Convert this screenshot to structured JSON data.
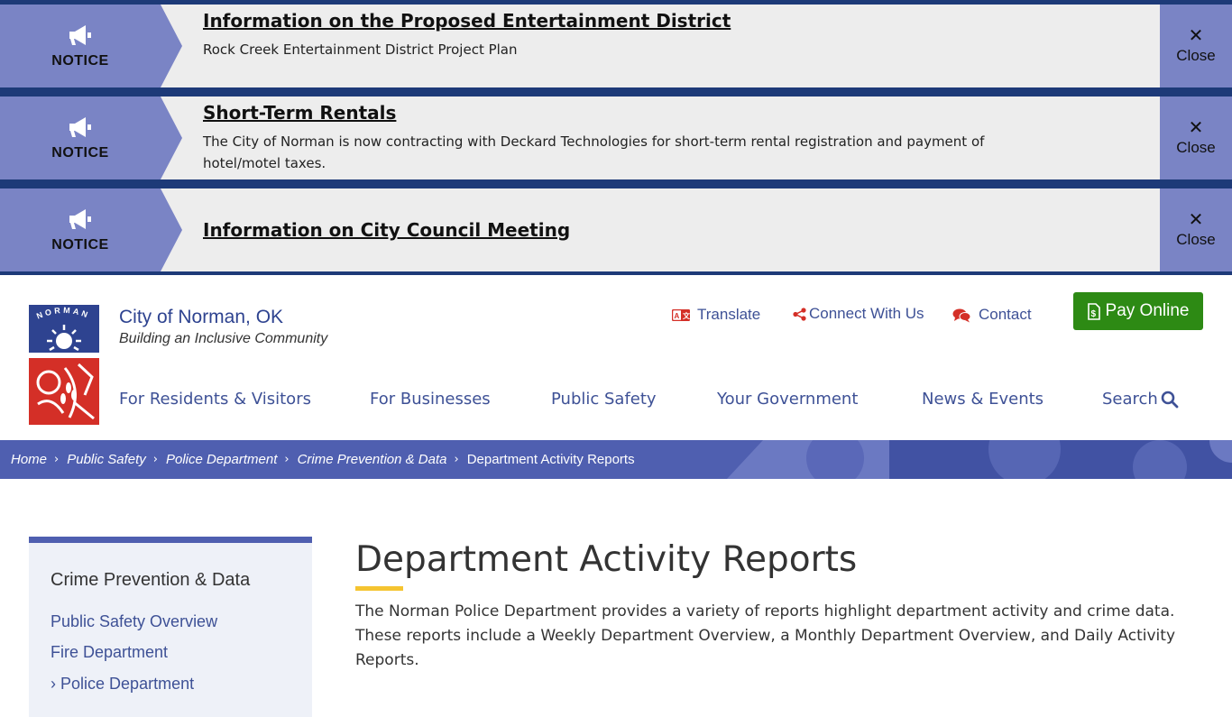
{
  "notices": [
    {
      "tag": "NOTICE",
      "title": "Information on the Proposed Entertainment District",
      "text": "Rock Creek Entertainment District Project Plan",
      "close_label": "Close",
      "close_symbol": "✕",
      "icon": "megaphone-icon"
    },
    {
      "tag": "NOTICE",
      "title": "Short-Term Rentals",
      "text": "The City of Norman is now contracting with Deckard Technologies for short-term rental registration and payment of hotel/motel taxes.",
      "close_label": "Close",
      "close_symbol": "✕",
      "icon": "megaphone-icon"
    },
    {
      "tag": "NOTICE",
      "title": "Information on City Council Meeting",
      "text": "",
      "close_label": "Close",
      "close_symbol": "✕",
      "icon": "megaphone-icon"
    }
  ],
  "header": {
    "site_name": "City of Norman, OK",
    "tagline": "Building an Inclusive Community",
    "logo_text": "NORMAN",
    "utility": [
      {
        "label": "Translate",
        "icon": "translate-icon"
      },
      {
        "label": "Connect With Us",
        "icon": "share-icon"
      },
      {
        "label": "Contact",
        "icon": "chat-icon"
      }
    ],
    "pay_label": "Pay Online",
    "pay_icon": "receipt-dollar-icon"
  },
  "nav": {
    "items": [
      "For Residents & Visitors",
      "For Businesses",
      "Public Safety",
      "Your Government",
      "News & Events"
    ],
    "search_label": "Search",
    "search_icon": "search-icon"
  },
  "breadcrumb": {
    "items": [
      "Home",
      "Public Safety",
      "Police Department",
      "Crime Prevention & Data"
    ],
    "current": "Department Activity Reports",
    "separator": "›"
  },
  "sidebar": {
    "title": "Crime Prevention & Data",
    "links": [
      "Public Safety Overview",
      "Fire Department",
      "Police Department"
    ],
    "active_marker": "›"
  },
  "main": {
    "title": "Department Activity Reports",
    "intro": "The Norman Police Department provides a variety of reports highlight department activity and crime data. These reports include a Weekly Department Overview, a Monthly Department Overview, and Daily Activity Reports."
  },
  "colors": {
    "navy": "#1d3a78",
    "notice_periwinkle": "#7a84c5",
    "brand_blue": "#3e5196",
    "crumb_bar": "#4f5fb0",
    "pay_green": "#2d8a14",
    "accent_yellow": "#f5c430"
  }
}
